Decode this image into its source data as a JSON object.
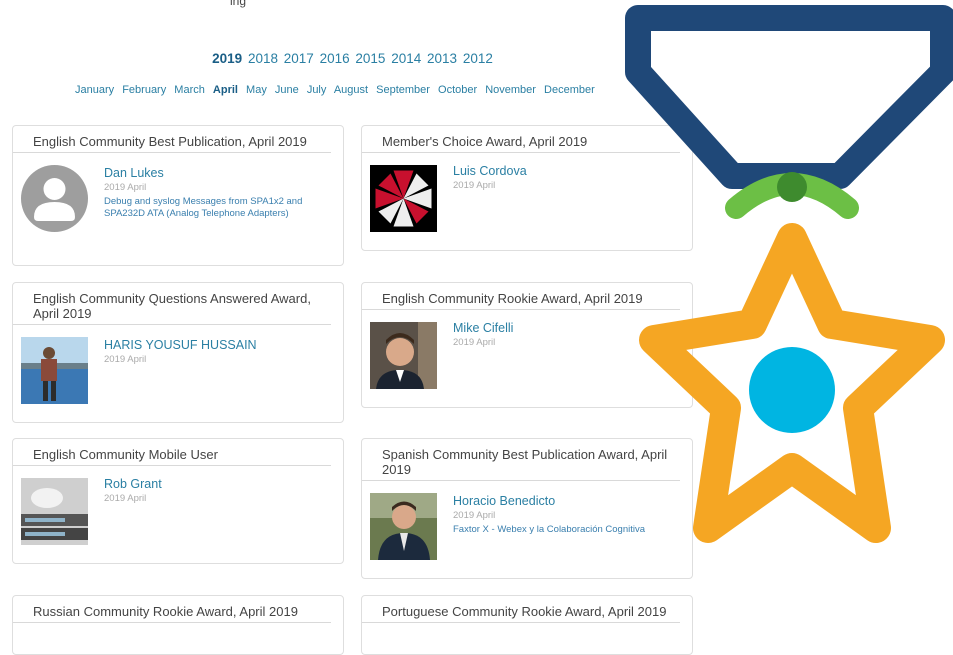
{
  "years": [
    "2019",
    "2018",
    "2017",
    "2016",
    "2015",
    "2014",
    "2013",
    "2012"
  ],
  "active_year": "2019",
  "months": [
    "January",
    "February",
    "March",
    "April",
    "May",
    "June",
    "July",
    "August",
    "September",
    "October",
    "November",
    "December"
  ],
  "active_month": "April",
  "cards": [
    {
      "title": "English Community Best Publication, April 2019",
      "name": "Dan Lukes",
      "date": "2019 April",
      "publication": "Debug and syslog Messages from SPA1x2 and SPA232D ATA (Analog Telephone Adapters)"
    },
    {
      "title": "Member's Choice Award, April 2019",
      "name": "Luis Cordova",
      "date": "2019 April"
    },
    {
      "title": "English Community Questions Answered Award, April 2019",
      "name": "HARIS YOUSUF HUSSAIN",
      "date": "2019 April"
    },
    {
      "title": "English Community Rookie Award, April 2019",
      "name": "Mike Cifelli",
      "date": "2019 April"
    },
    {
      "title": "English Community Mobile User",
      "name": "Rob Grant",
      "date": "2019 April"
    },
    {
      "title": "Spanish Community Best Publication Award, April 2019",
      "name": "Horacio Benedicto",
      "date": "2019 April",
      "publication": "Faxtor X - Webex y la Colaboración Cognitiva"
    },
    {
      "title": "Russian Community Rookie Award, April 2019"
    },
    {
      "title": "Portuguese Community Rookie Award, April 2019"
    }
  ],
  "colors": {
    "link": "#2a7fa3",
    "ribbon": "#1f4878",
    "ring": "#6cbf45",
    "star": "#f5a623",
    "dot": "#00b5e2"
  }
}
